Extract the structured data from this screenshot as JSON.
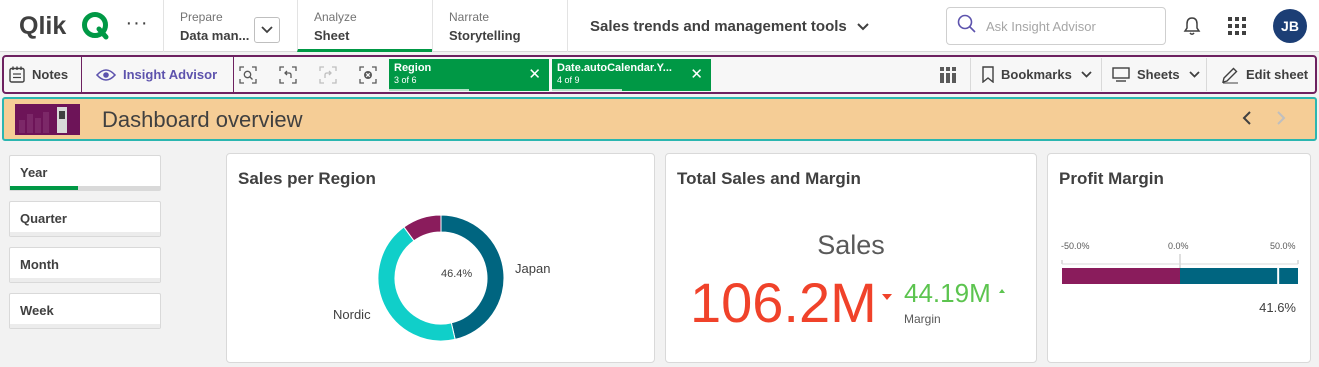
{
  "nav": {
    "logo_text": "Qlik",
    "prepare": {
      "label": "Prepare",
      "value": "Data man..."
    },
    "analyze": {
      "label": "Analyze",
      "value": "Sheet"
    },
    "narrate": {
      "label": "Narrate",
      "value": "Storytelling"
    },
    "app_title": "Sales trends and management tools",
    "search_placeholder": "Ask Insight Advisor",
    "avatar_initials": "JB"
  },
  "toolbar": {
    "notes": "Notes",
    "insight_advisor": "Insight Advisor",
    "selections": [
      {
        "field": "Region",
        "count": "3 of 6",
        "fraction": 0.5
      },
      {
        "field": "Date.autoCalendar.Y...",
        "count": "4 of 9",
        "fraction": 0.44
      }
    ],
    "bookmarks": "Bookmarks",
    "sheets": "Sheets",
    "edit_sheet": "Edit sheet"
  },
  "banner": {
    "title": "Dashboard overview",
    "bg_color": "#f5cd96",
    "border_color": "#2bb6b0"
  },
  "filters": [
    {
      "label": "Year",
      "selected": true
    },
    {
      "label": "Quarter",
      "selected": false
    },
    {
      "label": "Month",
      "selected": false
    },
    {
      "label": "Week",
      "selected": false
    }
  ],
  "cards": {
    "sales_per_region": {
      "title": "Sales per Region"
    },
    "total_sales": {
      "title": "Total Sales and Margin"
    },
    "profit_margin": {
      "title": "Profit Margin"
    }
  },
  "chart_data": [
    {
      "type": "pie",
      "title": "Sales per Region",
      "donut": true,
      "slices": [
        {
          "label": "Japan",
          "value": 46.4,
          "color": "#006580"
        },
        {
          "label": "Nordic",
          "value": 43.6,
          "color": "#10cfc9"
        },
        {
          "label": "",
          "value": 10.0,
          "color": "#8a1c5c"
        }
      ],
      "center_label": "46.4%"
    },
    {
      "type": "table",
      "title": "Total Sales and Margin",
      "kpi_label": "Sales",
      "main_value": "106.2M",
      "main_color": "#f0422a",
      "main_trend": "down",
      "secondary_value": "44.19M",
      "secondary_color": "#5cc44f",
      "secondary_trend": "up",
      "secondary_label": "Margin"
    },
    {
      "type": "bar",
      "title": "Profit Margin",
      "ticks": [
        "-50.0%",
        "0.0%",
        "50.0%"
      ],
      "xlim": [
        -50,
        50
      ],
      "segments": [
        {
          "from": -50,
          "to": 0,
          "color": "#8a1c5c"
        },
        {
          "from": 0,
          "to": 50,
          "color": "#006580"
        }
      ],
      "value": 41.6,
      "value_label": "41.6%"
    }
  ]
}
